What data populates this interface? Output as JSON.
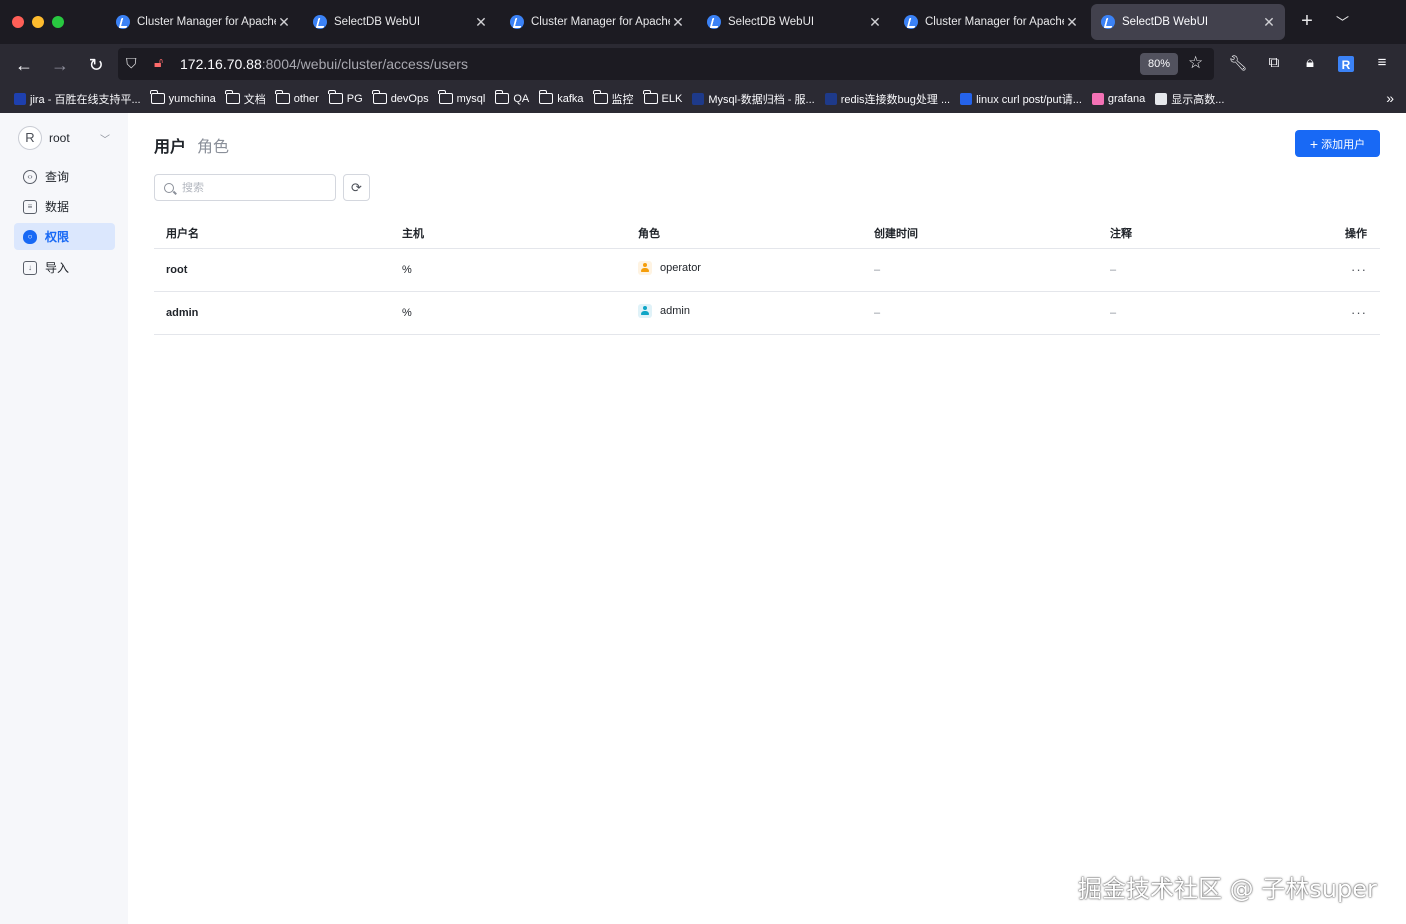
{
  "browser": {
    "tabs": [
      {
        "title": "Cluster Manager for Apache Doris",
        "active": false
      },
      {
        "title": "SelectDB WebUI",
        "active": false
      },
      {
        "title": "Cluster Manager for Apache Doris",
        "active": false
      },
      {
        "title": "SelectDB WebUI",
        "active": false
      },
      {
        "title": "Cluster Manager for Apache Doris",
        "active": false
      },
      {
        "title": "SelectDB WebUI",
        "active": true
      }
    ],
    "url_host": "172.16.70.88",
    "url_path": ":8004/webui/cluster/access/users",
    "zoom": "80%",
    "extension_r": "R",
    "bookmarks": [
      {
        "label": "jira - 百胜在线支持平...",
        "type": "site",
        "color": "#1e40af"
      },
      {
        "label": "yumchina",
        "type": "folder"
      },
      {
        "label": "文档",
        "type": "folder"
      },
      {
        "label": "other",
        "type": "folder"
      },
      {
        "label": "PG",
        "type": "folder"
      },
      {
        "label": "devOps",
        "type": "folder"
      },
      {
        "label": "mysql",
        "type": "folder"
      },
      {
        "label": "QA",
        "type": "folder"
      },
      {
        "label": "kafka",
        "type": "folder"
      },
      {
        "label": "监控",
        "type": "folder"
      },
      {
        "label": "ELK",
        "type": "folder"
      },
      {
        "label": "Mysql-数据归档 - 服...",
        "type": "site",
        "color": "#1e3a8a"
      },
      {
        "label": "redis连接数bug处理 ...",
        "type": "site",
        "color": "#1e3a8a"
      },
      {
        "label": "linux curl post/put请...",
        "type": "site",
        "color": "#2563eb"
      },
      {
        "label": "grafana",
        "type": "site",
        "color": "#f472b6"
      },
      {
        "label": "显示高数...",
        "type": "site",
        "color": "#e5e7eb"
      }
    ]
  },
  "sidebar": {
    "user_initial": "R",
    "user_name": "root",
    "items": [
      {
        "label": "查询",
        "icon": "code-icon",
        "active": false
      },
      {
        "label": "数据",
        "icon": "database-icon",
        "active": false
      },
      {
        "label": "权限",
        "icon": "shield-icon",
        "active": true
      },
      {
        "label": "导入",
        "icon": "import-icon",
        "active": false
      }
    ]
  },
  "main": {
    "tab_users": "用户",
    "tab_roles": "角色",
    "add_user_label": "添加用户",
    "search_placeholder": "搜索",
    "columns": [
      "用户名",
      "主机",
      "角色",
      "创建时间",
      "注释",
      "操作"
    ],
    "rows": [
      {
        "username": "root",
        "host": "%",
        "role": "operator",
        "created": "–",
        "comment": "–",
        "ops": "···"
      },
      {
        "username": "admin",
        "host": "%",
        "role": "admin",
        "created": "–",
        "comment": "–",
        "ops": "···"
      }
    ]
  },
  "watermark": "掘金技术社区 @ 子林super"
}
